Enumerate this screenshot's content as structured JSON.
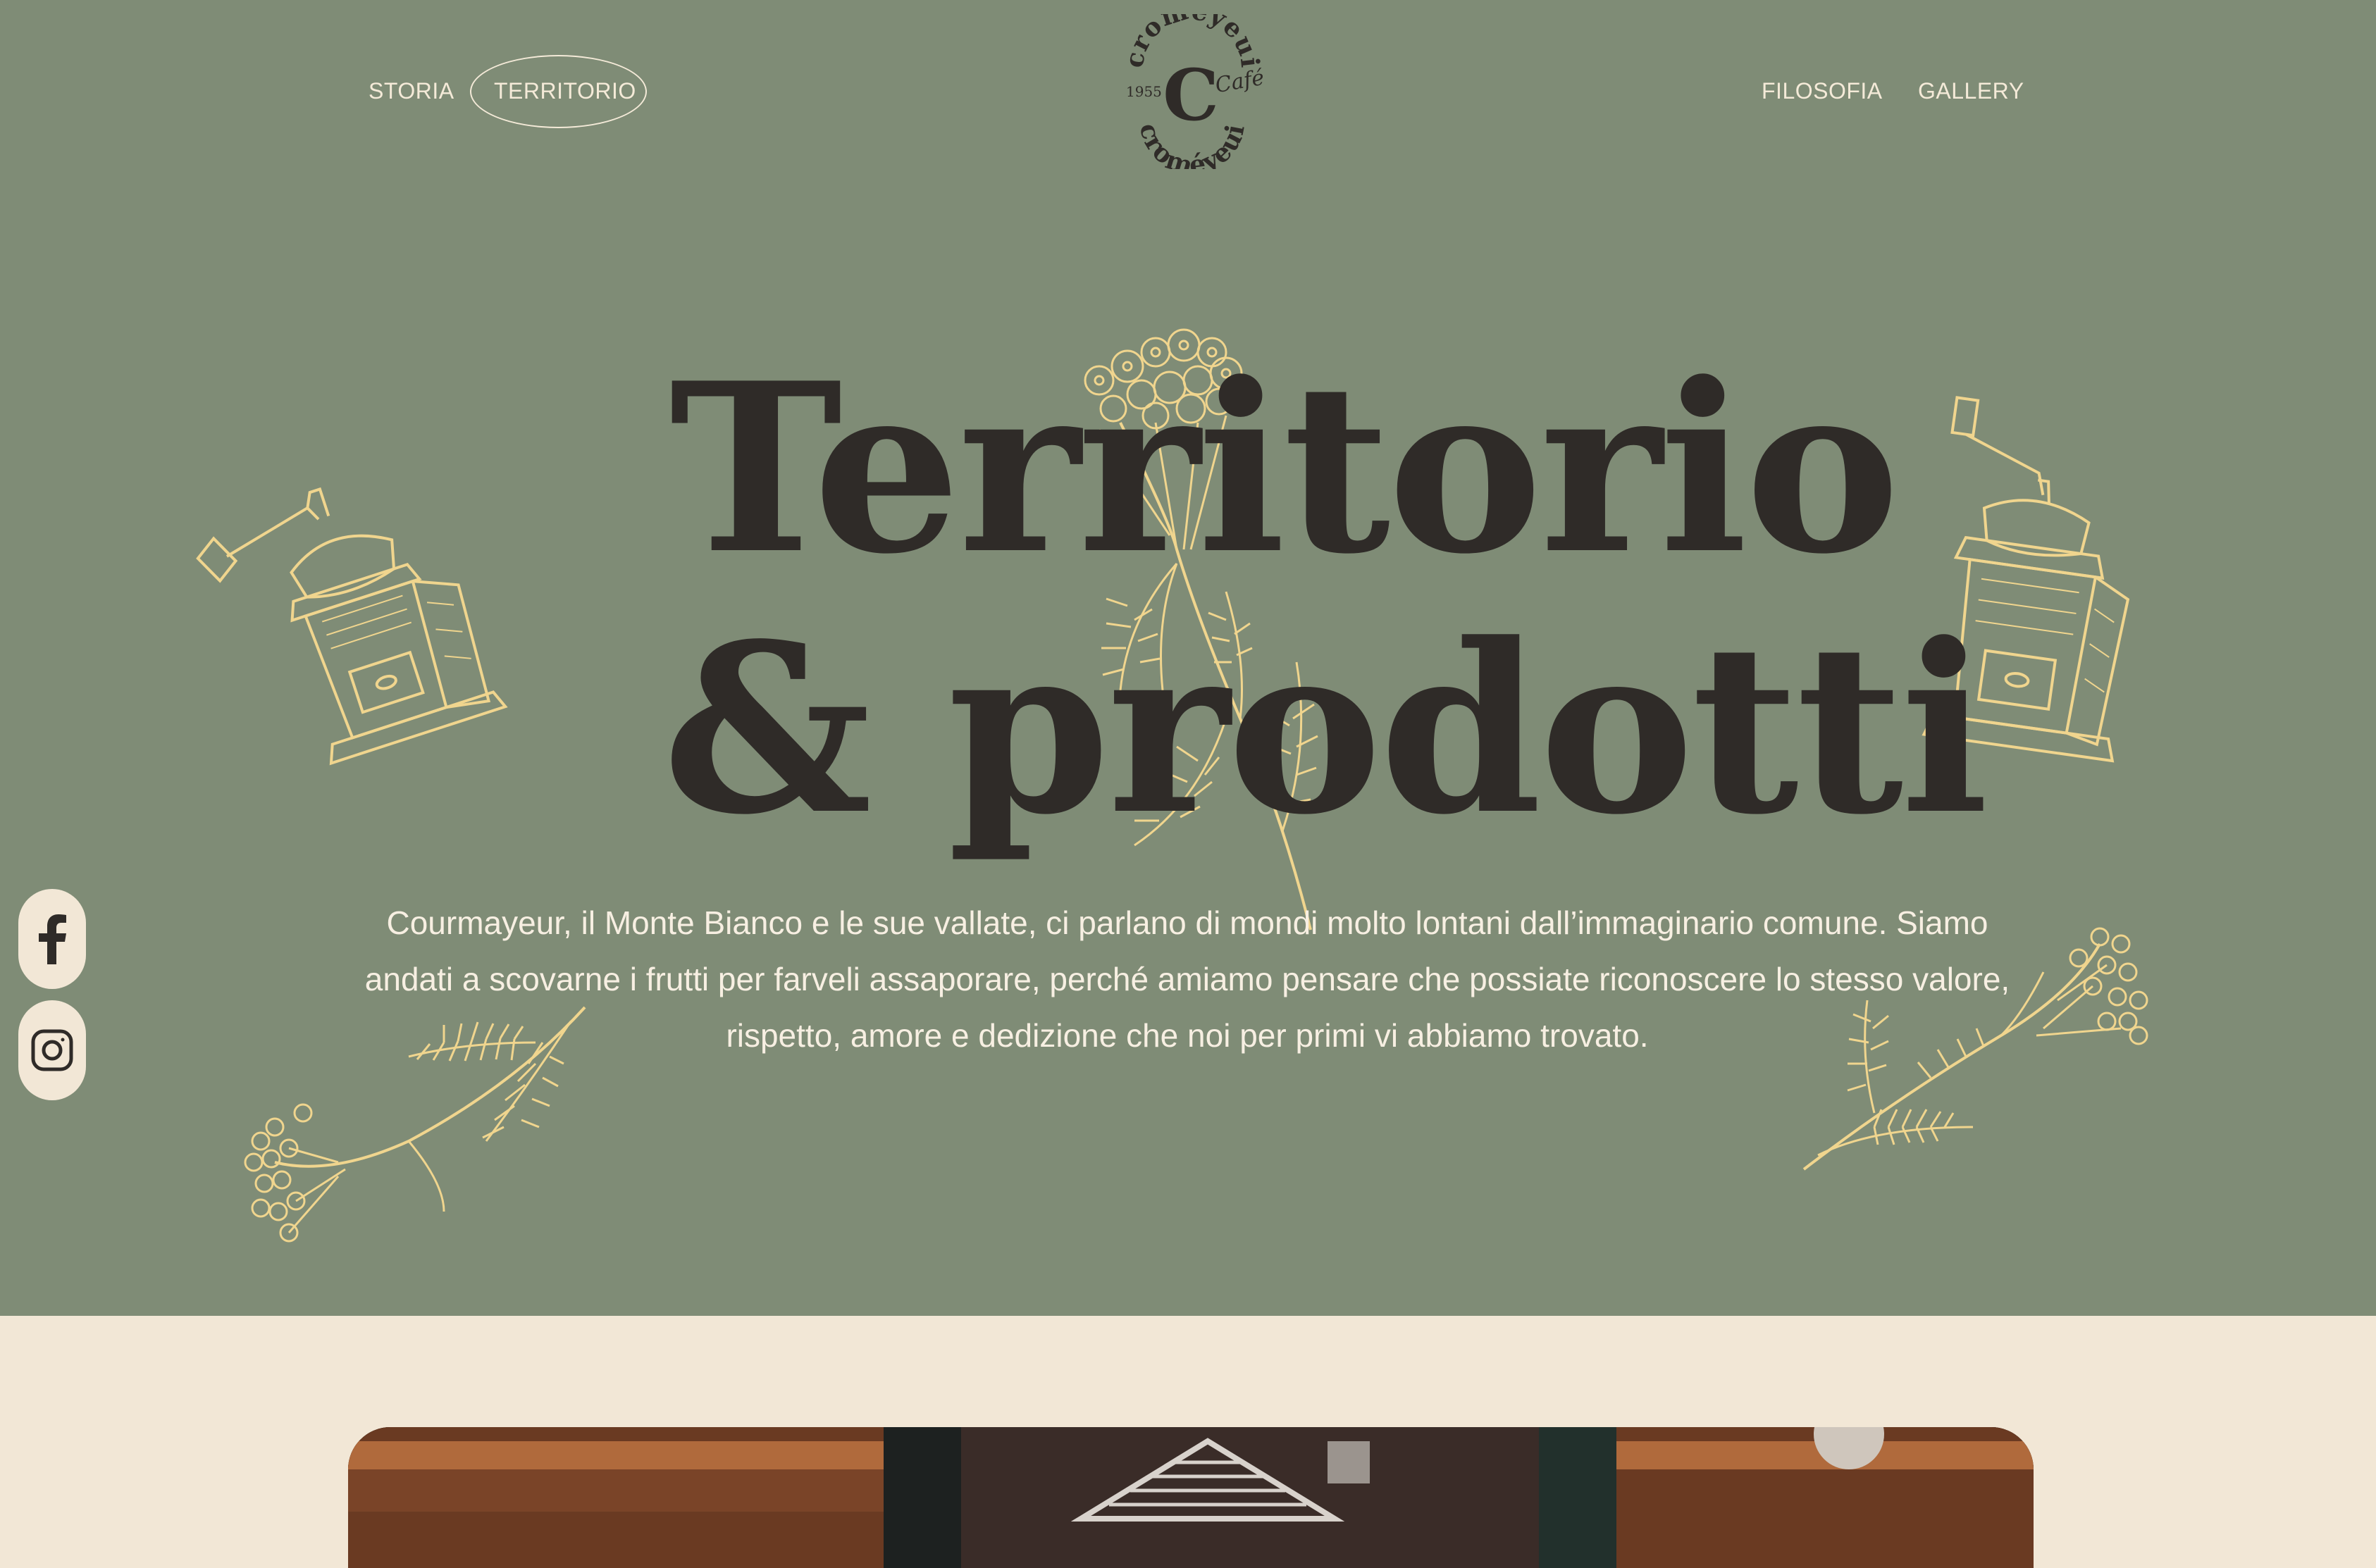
{
  "nav": {
    "left": [
      {
        "label": "STORIA",
        "active": false
      },
      {
        "label": "TERRITORIO",
        "active": true
      }
    ],
    "right": [
      {
        "label": "FILOSOFIA",
        "active": false
      },
      {
        "label": "GALLERY",
        "active": false
      }
    ]
  },
  "logo": {
    "arc_top": "croméyeui",
    "arc_bottom": "croméyeui",
    "monogram": "C",
    "year": "1955",
    "script": "Café"
  },
  "hero": {
    "title_line1": "Territorio",
    "title_line2": "& prodotti",
    "paragraph_lines": [
      "Courmayeur, il Monte Bianco e le sue vallate, ci parlano di mondi molto lontani dall’immaginario comune. Siamo",
      "andati a scovarne i frutti per farveli assaporare, perché amiamo pensare che possiate riconoscere lo stesso valore,",
      "rispetto, amore e dedizione che noi per primi vi abbiamo trovato."
    ]
  },
  "social": {
    "facebook_icon": "facebook-icon",
    "instagram_icon": "instagram-icon"
  },
  "colors": {
    "hero_bg": "#7f8c76",
    "page_bg": "#f2e7d6",
    "title": "#2f2b28",
    "illustration": "#f0d58e",
    "nav_text": "#f4ead8"
  }
}
